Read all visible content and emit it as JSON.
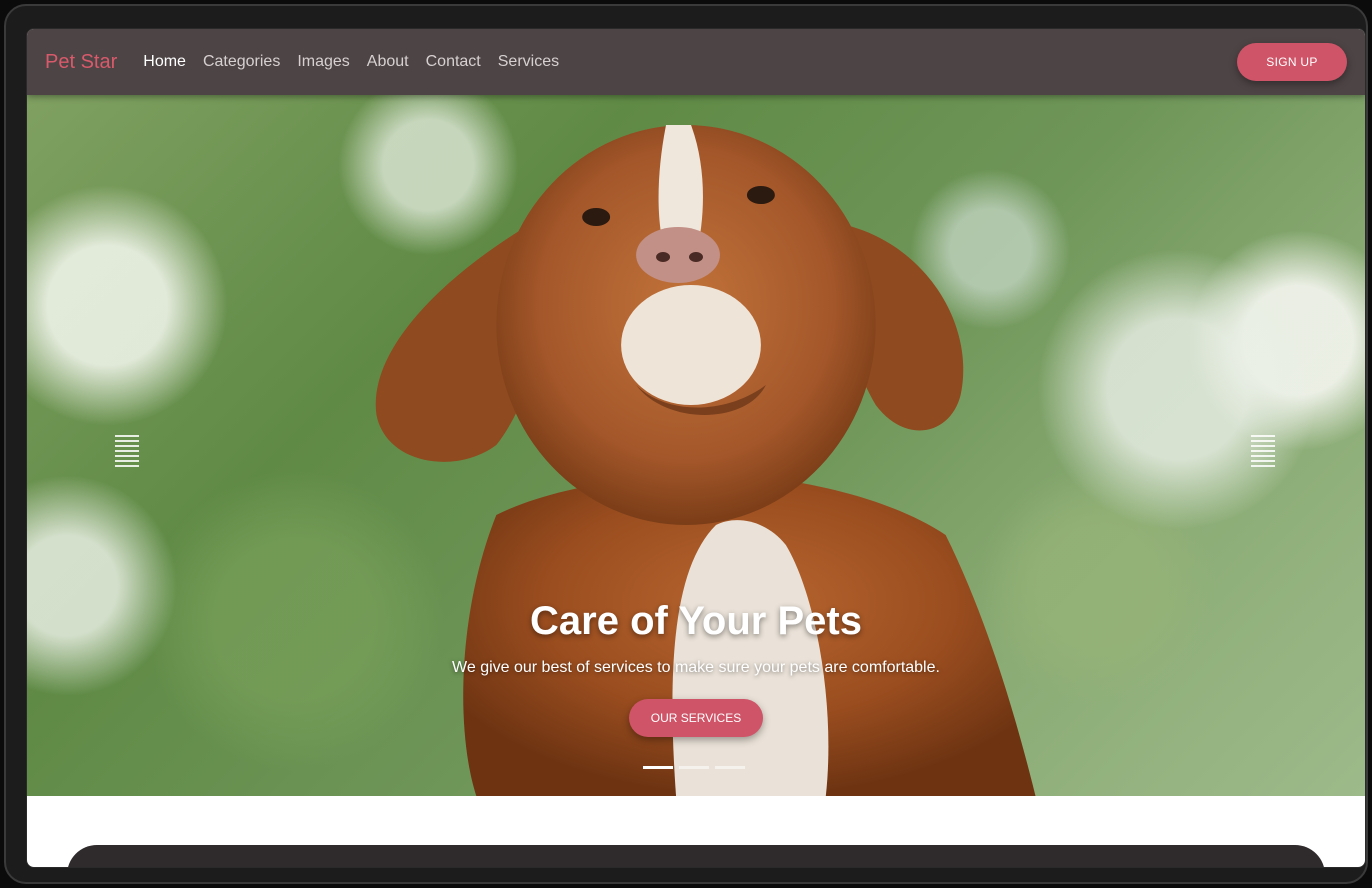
{
  "navbar": {
    "brand": "Pet Star",
    "links": [
      "Home",
      "Categories",
      "Images",
      "About",
      "Contact",
      "Services"
    ],
    "active": "Home",
    "signup_label": "SIGN UP"
  },
  "hero": {
    "title": "Care of Your Pets",
    "subtitle": "We give our best of services to make sure your pets are comfortable.",
    "button_label": "OUR SERVICES",
    "slides": 3,
    "active_slide": 1
  },
  "colors": {
    "accent": "#cf5468",
    "navbar": "#4d4445",
    "brand": "#d85a6b"
  },
  "icons": {
    "prev": "menu-lines-icon",
    "next": "menu-lines-icon"
  }
}
